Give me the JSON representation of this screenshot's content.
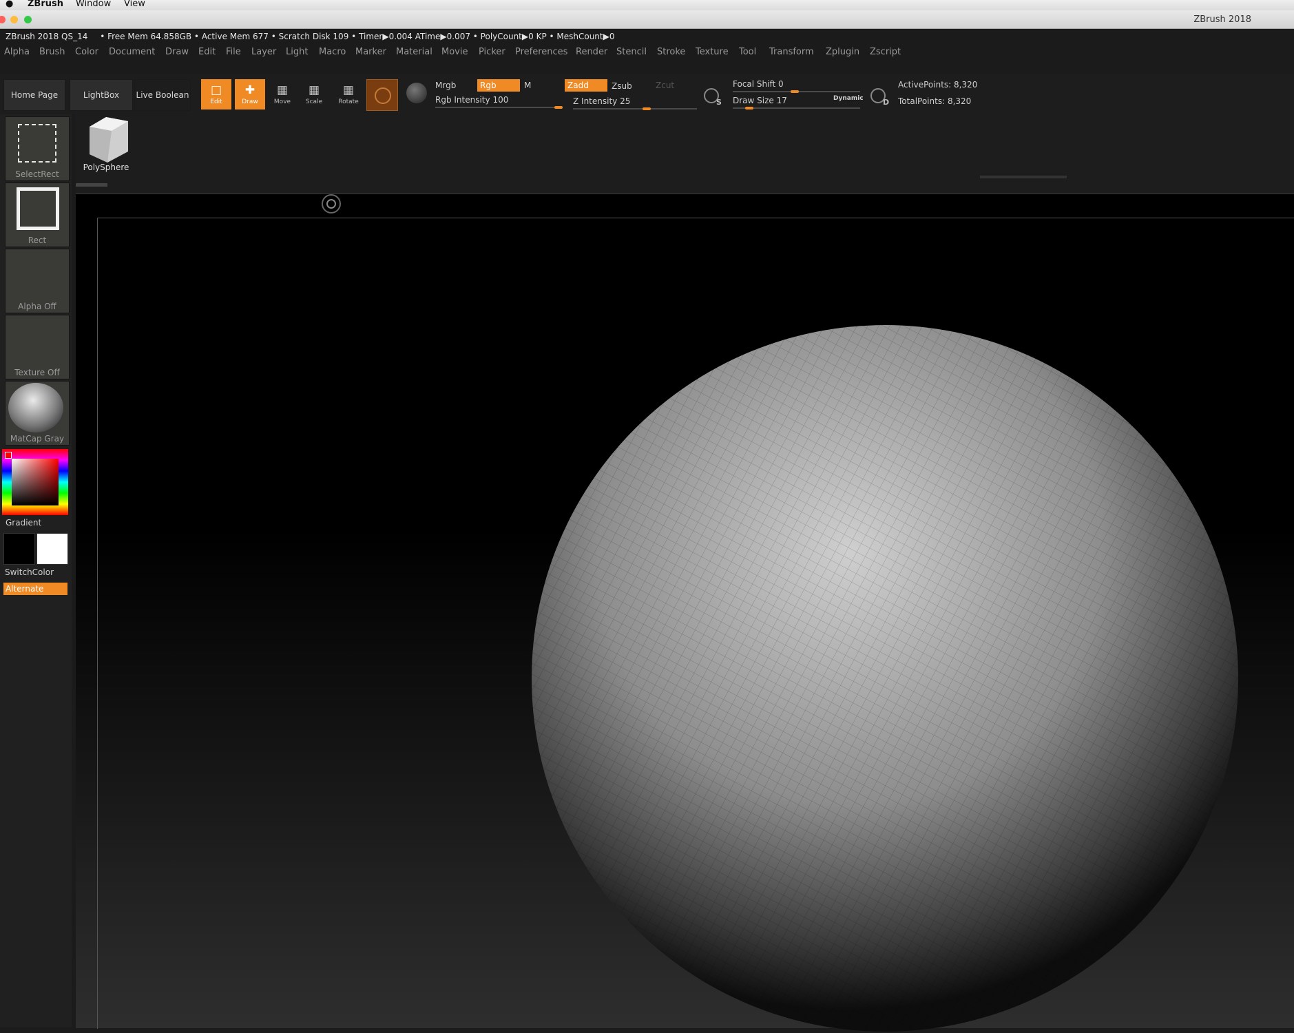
{
  "mac_menu": {
    "apple": "",
    "app": "ZBrush",
    "window": "Window",
    "view": "View"
  },
  "window_title": "ZBrush 2018",
  "status": {
    "version": "ZBrush 2018 QS_14",
    "stats": "• Free Mem 64.858GB • Active Mem 677 • Scratch Disk 109 • Timer▶0.004 ATime▶0.007 • PolyCount▶0 KP • MeshCount▶0"
  },
  "menus": [
    "Alpha",
    "Brush",
    "Color",
    "Document",
    "Draw",
    "Edit",
    "File",
    "Layer",
    "Light",
    "Macro",
    "Marker",
    "Material",
    "Movie",
    "Picker",
    "Preferences",
    "Render",
    "Stencil",
    "Stroke",
    "Texture",
    "Tool",
    "Transform",
    "Zplugin",
    "Zscript"
  ],
  "toolbar": {
    "home_page": "Home Page",
    "lightbox": "LightBox",
    "live_boolean": "Live Boolean",
    "edit": "Edit",
    "draw": "Draw",
    "move": "Move",
    "scale": "Scale",
    "rotate": "Rotate",
    "mrgb": "Mrgb",
    "rgb": "Rgb",
    "m": "M",
    "zadd": "Zadd",
    "zsub": "Zsub",
    "zcut": "Zcut",
    "rgb_intensity_label": "Rgb Intensity",
    "rgb_intensity": "100",
    "rgb_intensity_level": 1.0,
    "z_intensity_label": "Z Intensity",
    "z_intensity": "25",
    "z_intensity_level": 0.25,
    "focal_shift_label": "Focal Shift",
    "focal_shift": "0",
    "draw_size_label": "Draw Size",
    "draw_size": "17",
    "dynamic": "Dynamic",
    "s_letter": "S",
    "d_letter": "D",
    "active_points_label": "ActivePoints:",
    "active_points": "8,320",
    "total_points_label": "TotalPoints:",
    "total_points": "8,320"
  },
  "left_panel": {
    "select_rect": "SelectRect",
    "rect": "Rect",
    "alpha_off": "Alpha Off",
    "texture_off": "Texture Off",
    "matcap": "MatCap Gray",
    "gradient": "Gradient",
    "switch_color": "SwitchColor",
    "alternate": "Alternate"
  },
  "tool_thumbnail": {
    "label": "PolySphere"
  },
  "colors": {
    "accent": "#f08a24",
    "background": "#1b1b1b"
  }
}
